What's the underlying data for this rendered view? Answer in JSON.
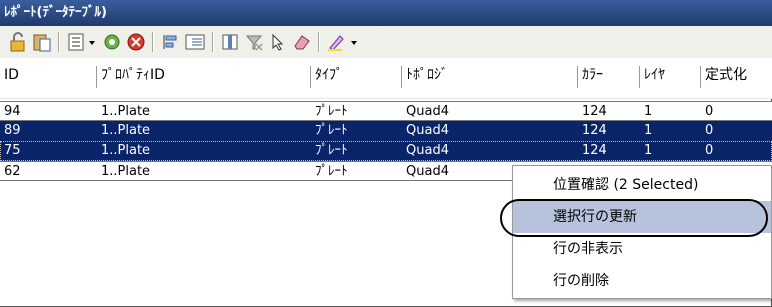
{
  "window": {
    "title": "ﾚﾎﾟｰﾄ(ﾃﾞｰﾀﾃｰﾌﾞﾙ)"
  },
  "toolbar": {
    "icons": [
      "lock-open-icon",
      "paste-icon",
      "list-icon",
      "dropdown-arrow-icon",
      "gear-green-icon",
      "delete-red-icon",
      "align-left-icon",
      "numbered-list-icon",
      "column-icon",
      "filter-clear-icon",
      "pointer-icon",
      "eraser-icon",
      "highlighter-icon",
      "dropdown-arrow-icon"
    ]
  },
  "table": {
    "columns": [
      "ID",
      "ﾌﾟﾛﾊﾟﾃｨID",
      "ﾀｲﾌﾟ",
      "ﾄﾎﾟﾛｼﾞ",
      "ｶﾗｰ",
      "ﾚｲﾔ",
      "定式化"
    ],
    "rows": [
      {
        "id": "94",
        "prop": "1..Plate",
        "type": "ﾌﾟﾚｰﾄ",
        "topo": "Quad4",
        "color": "124",
        "layer": "1",
        "form": "0",
        "selected": false
      },
      {
        "id": "89",
        "prop": "1..Plate",
        "type": "ﾌﾟﾚｰﾄ",
        "topo": "Quad4",
        "color": "124",
        "layer": "1",
        "form": "0",
        "selected": true
      },
      {
        "id": "75",
        "prop": "1..Plate",
        "type": "ﾌﾟﾚｰﾄ",
        "topo": "Quad4",
        "color": "124",
        "layer": "1",
        "form": "0",
        "selected": true
      },
      {
        "id": "62",
        "prop": "1..Plate",
        "type": "ﾌﾟﾚｰﾄ",
        "topo": "Quad4",
        "color": "",
        "layer": "",
        "form": "",
        "selected": false
      }
    ]
  },
  "context_menu": {
    "items": [
      "位置確認 (2 Selected)",
      "選択行の更新",
      "行の非表示",
      "行の削除"
    ],
    "highlighted_index": 1
  },
  "colors": {
    "title_bg": "#203a6e",
    "selected_row": "#0a246a",
    "menu_highlight": "#b7c3dd"
  }
}
